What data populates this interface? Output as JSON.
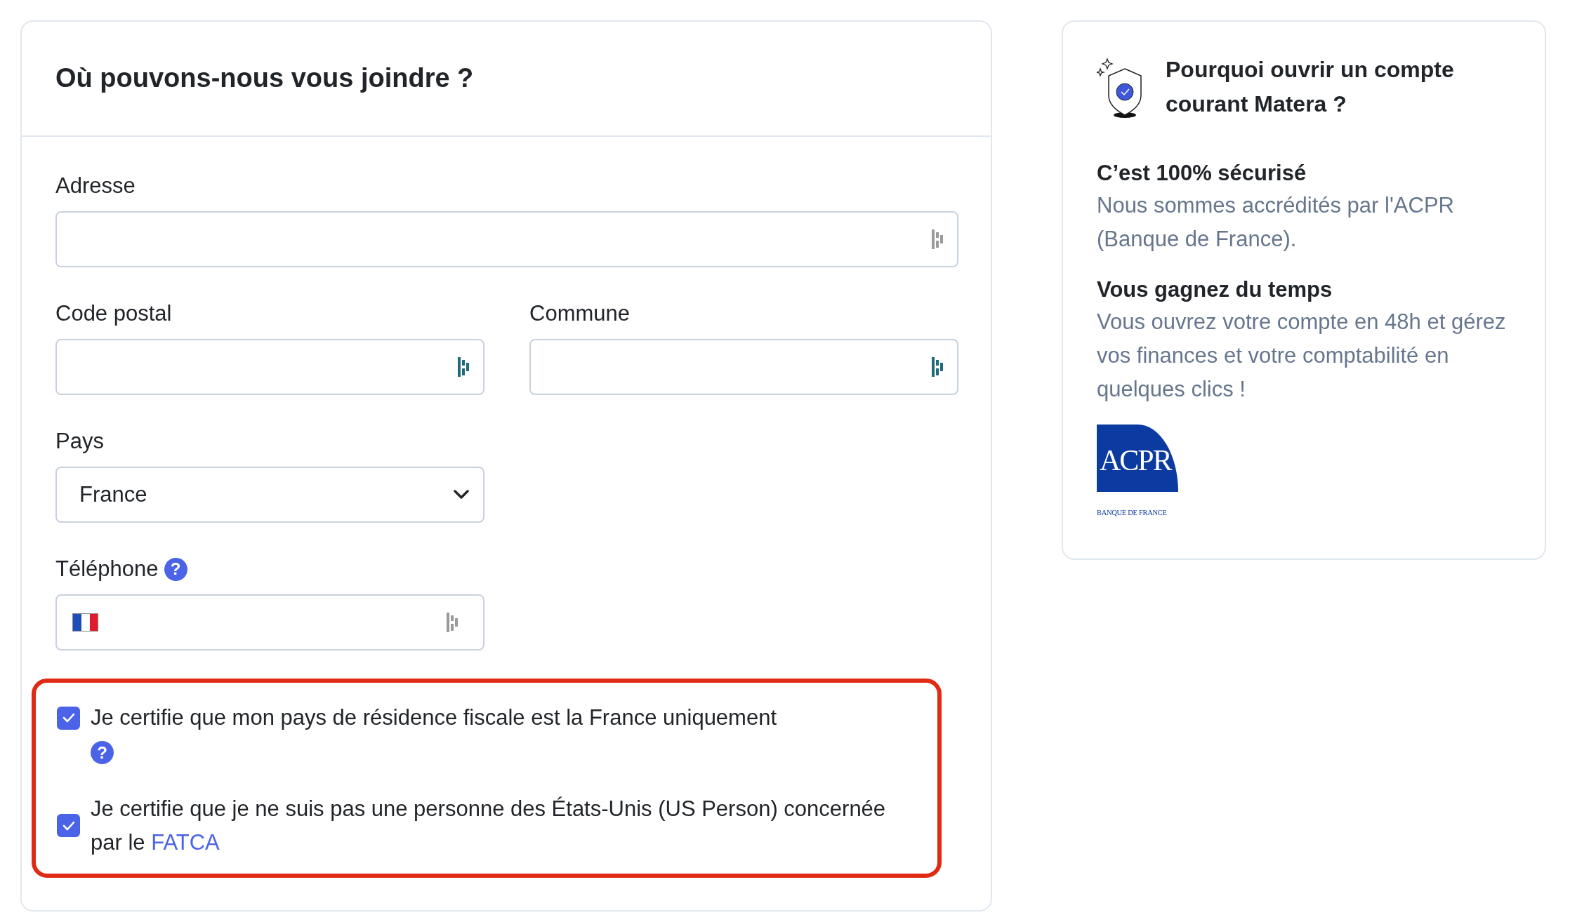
{
  "form": {
    "title": "Où pouvons-nous vous joindre ?",
    "rows": [
      [
        {
          "kind": "text",
          "label": "Adresse",
          "color": "#9a9a9a"
        }
      ],
      [
        {
          "kind": "text",
          "label": "Code postal",
          "color": "#1f6b78"
        },
        {
          "kind": "text",
          "label": "Commune",
          "color": "#1f6b78"
        }
      ],
      [
        {
          "kind": "select",
          "label": "Pays",
          "value": "France"
        }
      ],
      [
        {
          "kind": "phone",
          "label": "Téléphone",
          "help": "?",
          "color": "#9a9a9a"
        }
      ]
    ],
    "certifications": {
      "highlighted": true,
      "items": [
        {
          "text": "Je certifie que mon pays de résidence fiscale est la France uniquement",
          "checked": true,
          "help": "?"
        },
        {
          "text": "Je certifie que je ne suis pas une personne des États-Unis (US Person) concernée par le ",
          "link": "FATCA",
          "checked": true
        }
      ]
    }
  },
  "aside": {
    "title": "Pourquoi ouvrir un compte courant Matera ?",
    "sections": [
      {
        "heading": "C’est 100% sécurisé",
        "text": "Nous sommes accrédités par l'ACPR (Banque de France)."
      },
      {
        "heading": "Vous gagnez du temps",
        "text": "Vous ouvrez votre compte en 48h et gérez vos finances et votre comptabilité en quelques clics !"
      }
    ],
    "logo": {
      "title": "ACPR",
      "subtitle": "BANQUE DE FRANCE"
    }
  }
}
